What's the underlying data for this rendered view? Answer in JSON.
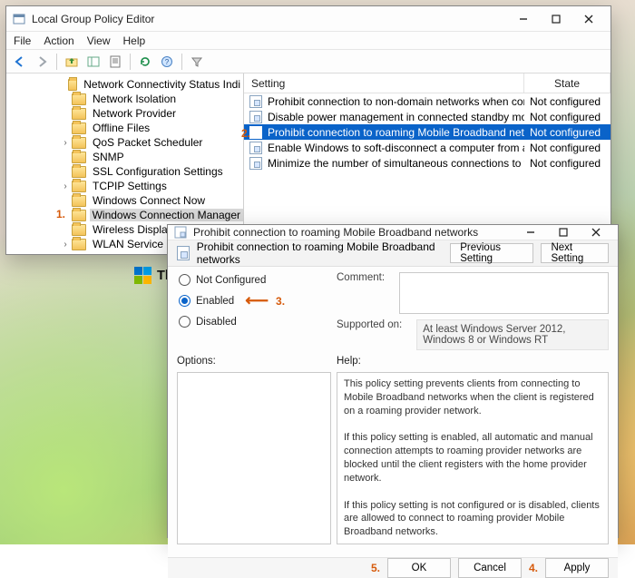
{
  "watermark": "TheWindowsClub",
  "annotations": {
    "n1": "1.",
    "n2": "2.",
    "n3": "3.",
    "n4": "4.",
    "n5": "5."
  },
  "gp": {
    "title": "Local Group Policy Editor",
    "menus": {
      "file": "File",
      "action": "Action",
      "view": "View",
      "help": "Help"
    },
    "tree": [
      {
        "label": "Network Connectivity Status Indi",
        "indent": "ind1",
        "twisty": ""
      },
      {
        "label": "Network Isolation",
        "indent": "ind1",
        "twisty": ""
      },
      {
        "label": "Network Provider",
        "indent": "ind1",
        "twisty": ""
      },
      {
        "label": "Offline Files",
        "indent": "ind1",
        "twisty": ""
      },
      {
        "label": "QoS Packet Scheduler",
        "indent": "ind1",
        "twisty": "›"
      },
      {
        "label": "SNMP",
        "indent": "ind1",
        "twisty": ""
      },
      {
        "label": "SSL Configuration Settings",
        "indent": "ind1",
        "twisty": ""
      },
      {
        "label": "TCPIP Settings",
        "indent": "ind1",
        "twisty": "›"
      },
      {
        "label": "Windows Connect Now",
        "indent": "ind1",
        "twisty": ""
      },
      {
        "label": "Windows Connection Manager",
        "indent": "ind1",
        "twisty": "",
        "selected": true
      },
      {
        "label": "Wireless Display",
        "indent": "ind1",
        "twisty": ""
      },
      {
        "label": "WLAN Service",
        "indent": "ind1",
        "twisty": "›"
      }
    ],
    "list": {
      "headers": {
        "setting": "Setting",
        "state": "State"
      },
      "rows": [
        {
          "setting": "Prohibit connection to non-domain networks when connec…",
          "state": "Not configured"
        },
        {
          "setting": "Disable power management in connected standby mode",
          "state": "Not configured"
        },
        {
          "setting": "Prohibit connection to roaming Mobile Broadband networks",
          "state": "Not configured",
          "selected": true
        },
        {
          "setting": "Enable Windows to soft-disconnect a computer from a net…",
          "state": "Not configured"
        },
        {
          "setting": "Minimize the number of simultaneous connections to the In…",
          "state": "Not configured"
        }
      ]
    }
  },
  "dlg": {
    "title": "Prohibit connection to roaming Mobile Broadband networks",
    "subtitle": "Prohibit connection to roaming Mobile Broadband networks",
    "buttons": {
      "prev": "Previous Setting",
      "next": "Next Setting",
      "ok": "OK",
      "cancel": "Cancel",
      "apply": "Apply"
    },
    "radios": {
      "notcfg": "Not Configured",
      "enabled": "Enabled",
      "disabled": "Disabled",
      "selected": "enabled"
    },
    "labels": {
      "comment": "Comment:",
      "supported": "Supported on:",
      "options": "Options:",
      "help": "Help:"
    },
    "supported_text": "At least Windows Server 2012, Windows 8 or Windows RT",
    "comment_text": "",
    "options_text": "",
    "help_text": "This policy setting prevents clients from connecting to Mobile Broadband networks when the client is registered on a roaming provider network.\n\nIf this policy setting is enabled, all automatic and manual connection attempts to roaming provider networks are blocked until the client registers with the home provider network.\n\nIf this policy setting is not configured or is disabled, clients are allowed to connect to roaming provider Mobile Broadband networks."
  }
}
